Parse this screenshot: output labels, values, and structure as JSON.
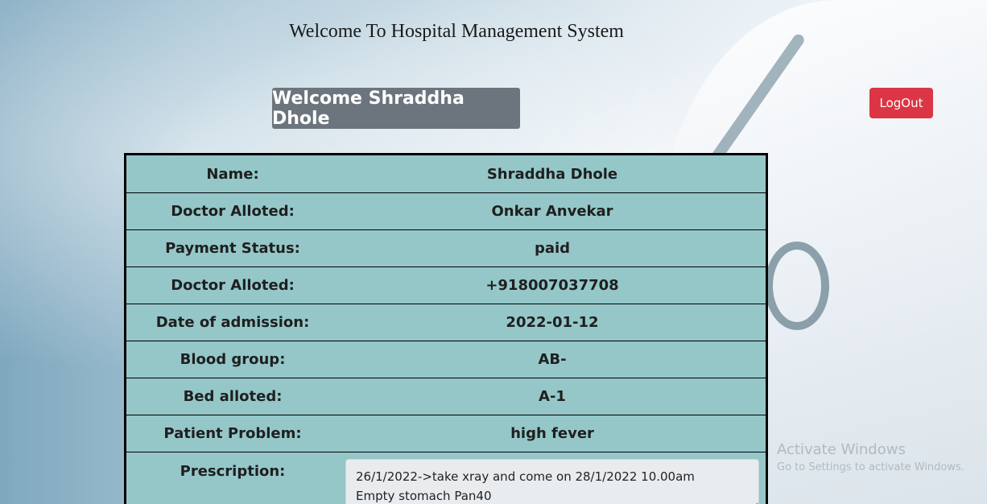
{
  "page": {
    "title": "Welcome To Hospital Management System",
    "welcome": "Welcome Shraddha Dhole",
    "logout_label": "LogOut"
  },
  "patient": {
    "rows": [
      {
        "label": "Name:",
        "value": "Shraddha Dhole"
      },
      {
        "label": "Doctor Alloted:",
        "value": "Onkar Anvekar"
      },
      {
        "label": "Payment Status:",
        "value": "paid"
      },
      {
        "label": "Doctor Alloted:",
        "value": "+918007037708"
      },
      {
        "label": "Date of admission:",
        "value": "2022-01-12"
      },
      {
        "label": "Blood group:",
        "value": "AB-"
      },
      {
        "label": "Bed alloted:",
        "value": "A-1"
      },
      {
        "label": "Patient Problem:",
        "value": "high fever"
      }
    ],
    "prescription_label": "Prescription:",
    "prescription_lines": [
      "26/1/2022->take xray and come on 28/1/2022 10.00am",
      "Empty stomach Pan40"
    ]
  },
  "watermark": {
    "line1": "Activate Windows",
    "line2": "Go to Settings to activate Windows."
  },
  "colors": {
    "table_bg": "#95c7c9",
    "welcome_bg": "#6c757d",
    "logout_bg": "#dc3545"
  }
}
